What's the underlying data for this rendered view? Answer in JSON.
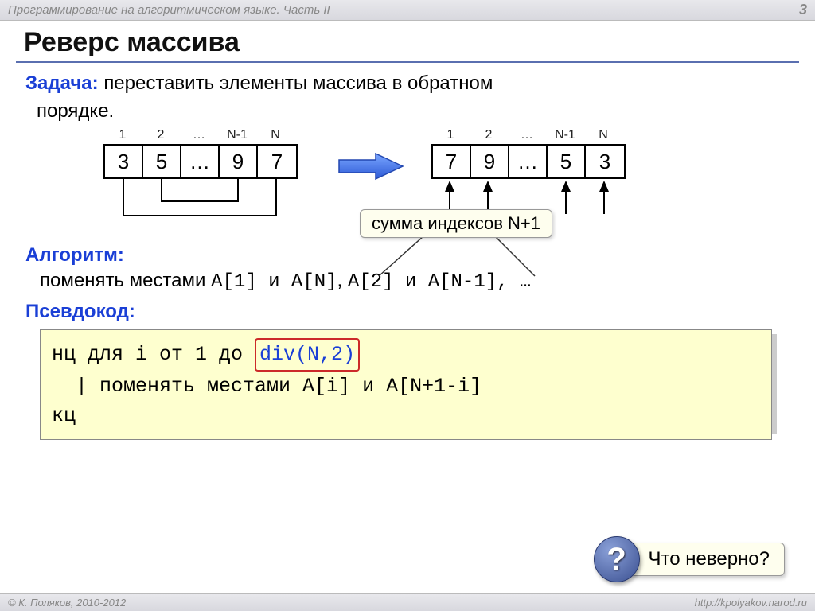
{
  "header": {
    "title": "Программирование на алгоритмическом языке. Часть II",
    "page": "3"
  },
  "slide_title": "Реверс массива",
  "task": {
    "label": "Задача:",
    "text1": "переставить элементы массива в обратном",
    "text2": "порядке."
  },
  "arrays": {
    "indices": [
      "1",
      "2",
      "…",
      "N-1",
      "N"
    ],
    "before": [
      "3",
      "5",
      "…",
      "9",
      "7"
    ],
    "after": [
      "7",
      "9",
      "…",
      "5",
      "3"
    ]
  },
  "callout": "сумма индексов N+1",
  "algorithm": {
    "label": "Алгоритм:",
    "line_prefix": "поменять местами ",
    "swap1": "A[1] и A[N]",
    "comma": ", ",
    "swap2": "A[2] и A[N-1]",
    "tail": ", …"
  },
  "pseudocode": {
    "label": "Псевдокод:",
    "line1a": "нц для i от 1 до ",
    "div": "div(N,2)",
    "line2": "  | поменять местами A[i] и A[N+1-i]",
    "line3": "кц"
  },
  "hint": {
    "q": "?",
    "text": "Что неверно?"
  },
  "footer": {
    "left": "© К. Поляков, 2010-2012",
    "right": "http://kpolyakov.narod.ru"
  }
}
